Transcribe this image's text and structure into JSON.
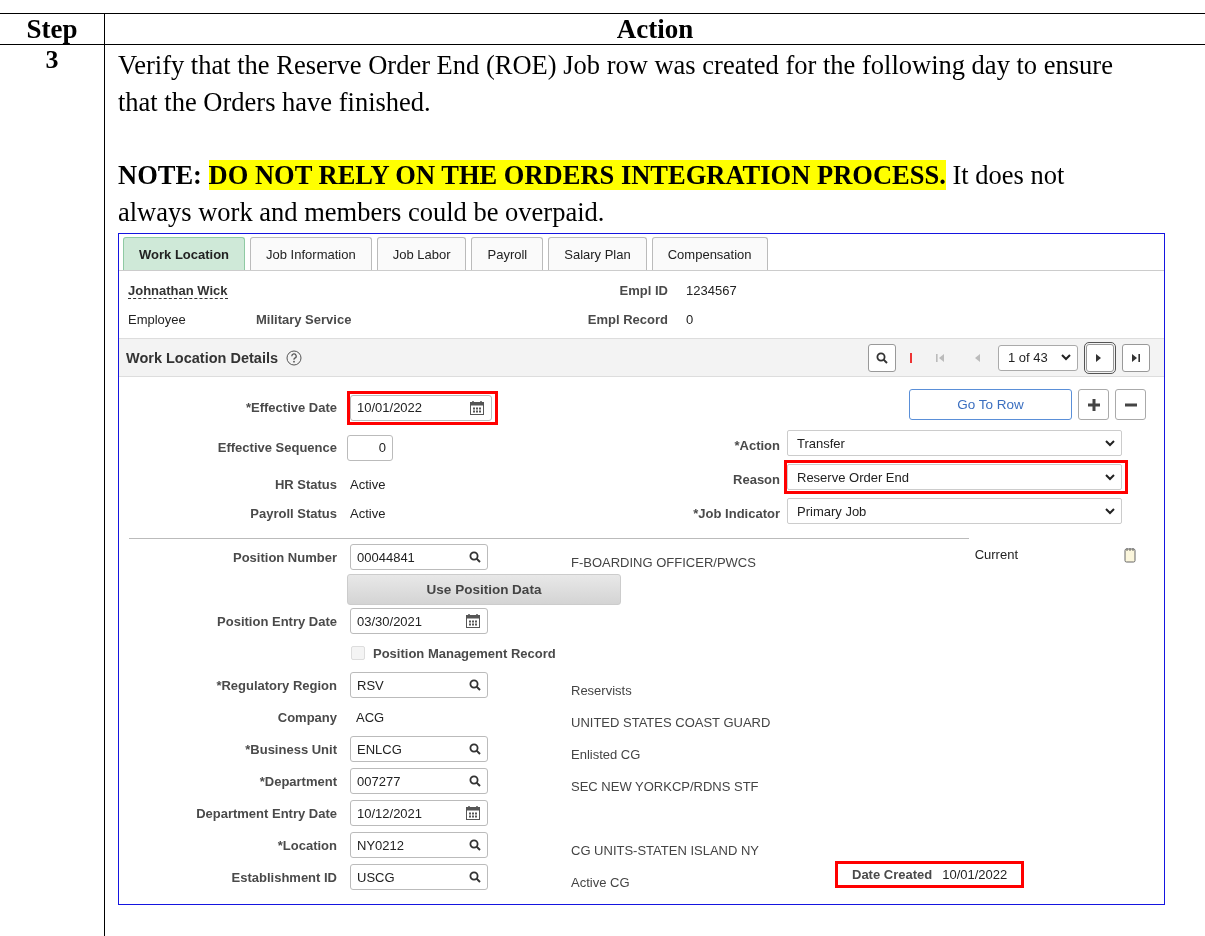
{
  "table": {
    "columns": [
      "Step",
      "Action"
    ]
  },
  "step": {
    "number": "3",
    "instruction": "Verify that the Reserve Order End (ROE) Job row was created for the following day to ensure that the Orders have finished.",
    "note_label": "NOTE:",
    "note_highlight": "DO NOT RELY ON THE ORDERS INTEGRATION PROCESS.",
    "note_text": "It does not always work and members could be overpaid."
  },
  "screen": {
    "tabs": [
      {
        "label": "Work Location",
        "selected": true
      },
      {
        "label": "Job Information",
        "selected": false
      },
      {
        "label": "Job Labor",
        "selected": false
      },
      {
        "label": "Payroll",
        "selected": false
      },
      {
        "label": "Salary Plan",
        "selected": false
      },
      {
        "label": "Compensation",
        "selected": false
      }
    ],
    "employee": {
      "name": "Johnathan Wick",
      "type": "Employee",
      "category": "Military Service",
      "empl_id_label": "Empl ID",
      "empl_id": "1234567",
      "empl_record_label": "Empl Record",
      "empl_record": "0"
    },
    "section": {
      "title": "Work Location Details",
      "page": "1 of 43",
      "nav": [
        {
          "kind": "first",
          "disabled": true
        },
        {
          "kind": "previous",
          "disabled": true
        },
        {
          "kind": "next",
          "disabled": false
        },
        {
          "kind": "last",
          "disabled": false
        }
      ]
    },
    "top_fields": [
      {
        "kind": "date",
        "label": "*Effective Date",
        "value": "10/01/2022",
        "highlighted": true
      },
      {
        "kind": "number",
        "label": "Effective Sequence",
        "value": "0",
        "highlighted": false
      },
      {
        "kind": "status",
        "label": "HR Status",
        "value": "Active",
        "highlighted": false
      },
      {
        "kind": "status",
        "label": "Payroll Status",
        "value": "Active",
        "highlighted": false
      }
    ],
    "go_to_row": "Go To Row",
    "selects": [
      {
        "label": "*Action",
        "value": "Transfer",
        "highlighted": false
      },
      {
        "label": "Reason",
        "value": "Reserve Order End",
        "highlighted": true
      },
      {
        "label": "*Job Indicator",
        "value": "Primary Job",
        "highlighted": false
      }
    ],
    "rows": [
      {
        "kind": "lookup",
        "label": "Position Number",
        "value": "00044841",
        "description": "F-BOARDING OFFICER/PWCS",
        "highlighted": false
      },
      {
        "kind": "button",
        "label": "Use Position Data"
      },
      {
        "kind": "date",
        "label": "Position Entry Date",
        "value": "03/30/2021",
        "highlighted": false
      },
      {
        "kind": "checkbox",
        "label": "Position Management Record",
        "checked": false,
        "disabled": true
      },
      {
        "kind": "lookup",
        "label": "*Regulatory Region",
        "value": "RSV",
        "description": "Reservists",
        "highlighted": false
      },
      {
        "kind": "static",
        "label": "Company",
        "value": "ACG",
        "description": "UNITED STATES COAST GUARD",
        "highlighted": false
      },
      {
        "kind": "lookup",
        "label": "*Business Unit",
        "value": "ENLCG",
        "description": "Enlisted CG",
        "highlighted": false
      },
      {
        "kind": "lookup",
        "label": "*Department",
        "value": "007277",
        "description": "SEC NEW YORKCP/RDNS STF",
        "highlighted": false
      },
      {
        "kind": "date",
        "label": "Department Entry Date",
        "value": "10/12/2021",
        "highlighted": false
      },
      {
        "kind": "lookup",
        "label": "*Location",
        "value": "NY0212",
        "description": "CG UNITS-STATEN ISLAND NY",
        "highlighted": false
      },
      {
        "kind": "lookup",
        "label": "Establishment ID",
        "value": "USCG",
        "description": "Active CG",
        "highlighted": false
      }
    ],
    "status": "Current",
    "date_created": {
      "label": "Date Created",
      "value": "10/01/2022",
      "highlighted": true
    }
  }
}
